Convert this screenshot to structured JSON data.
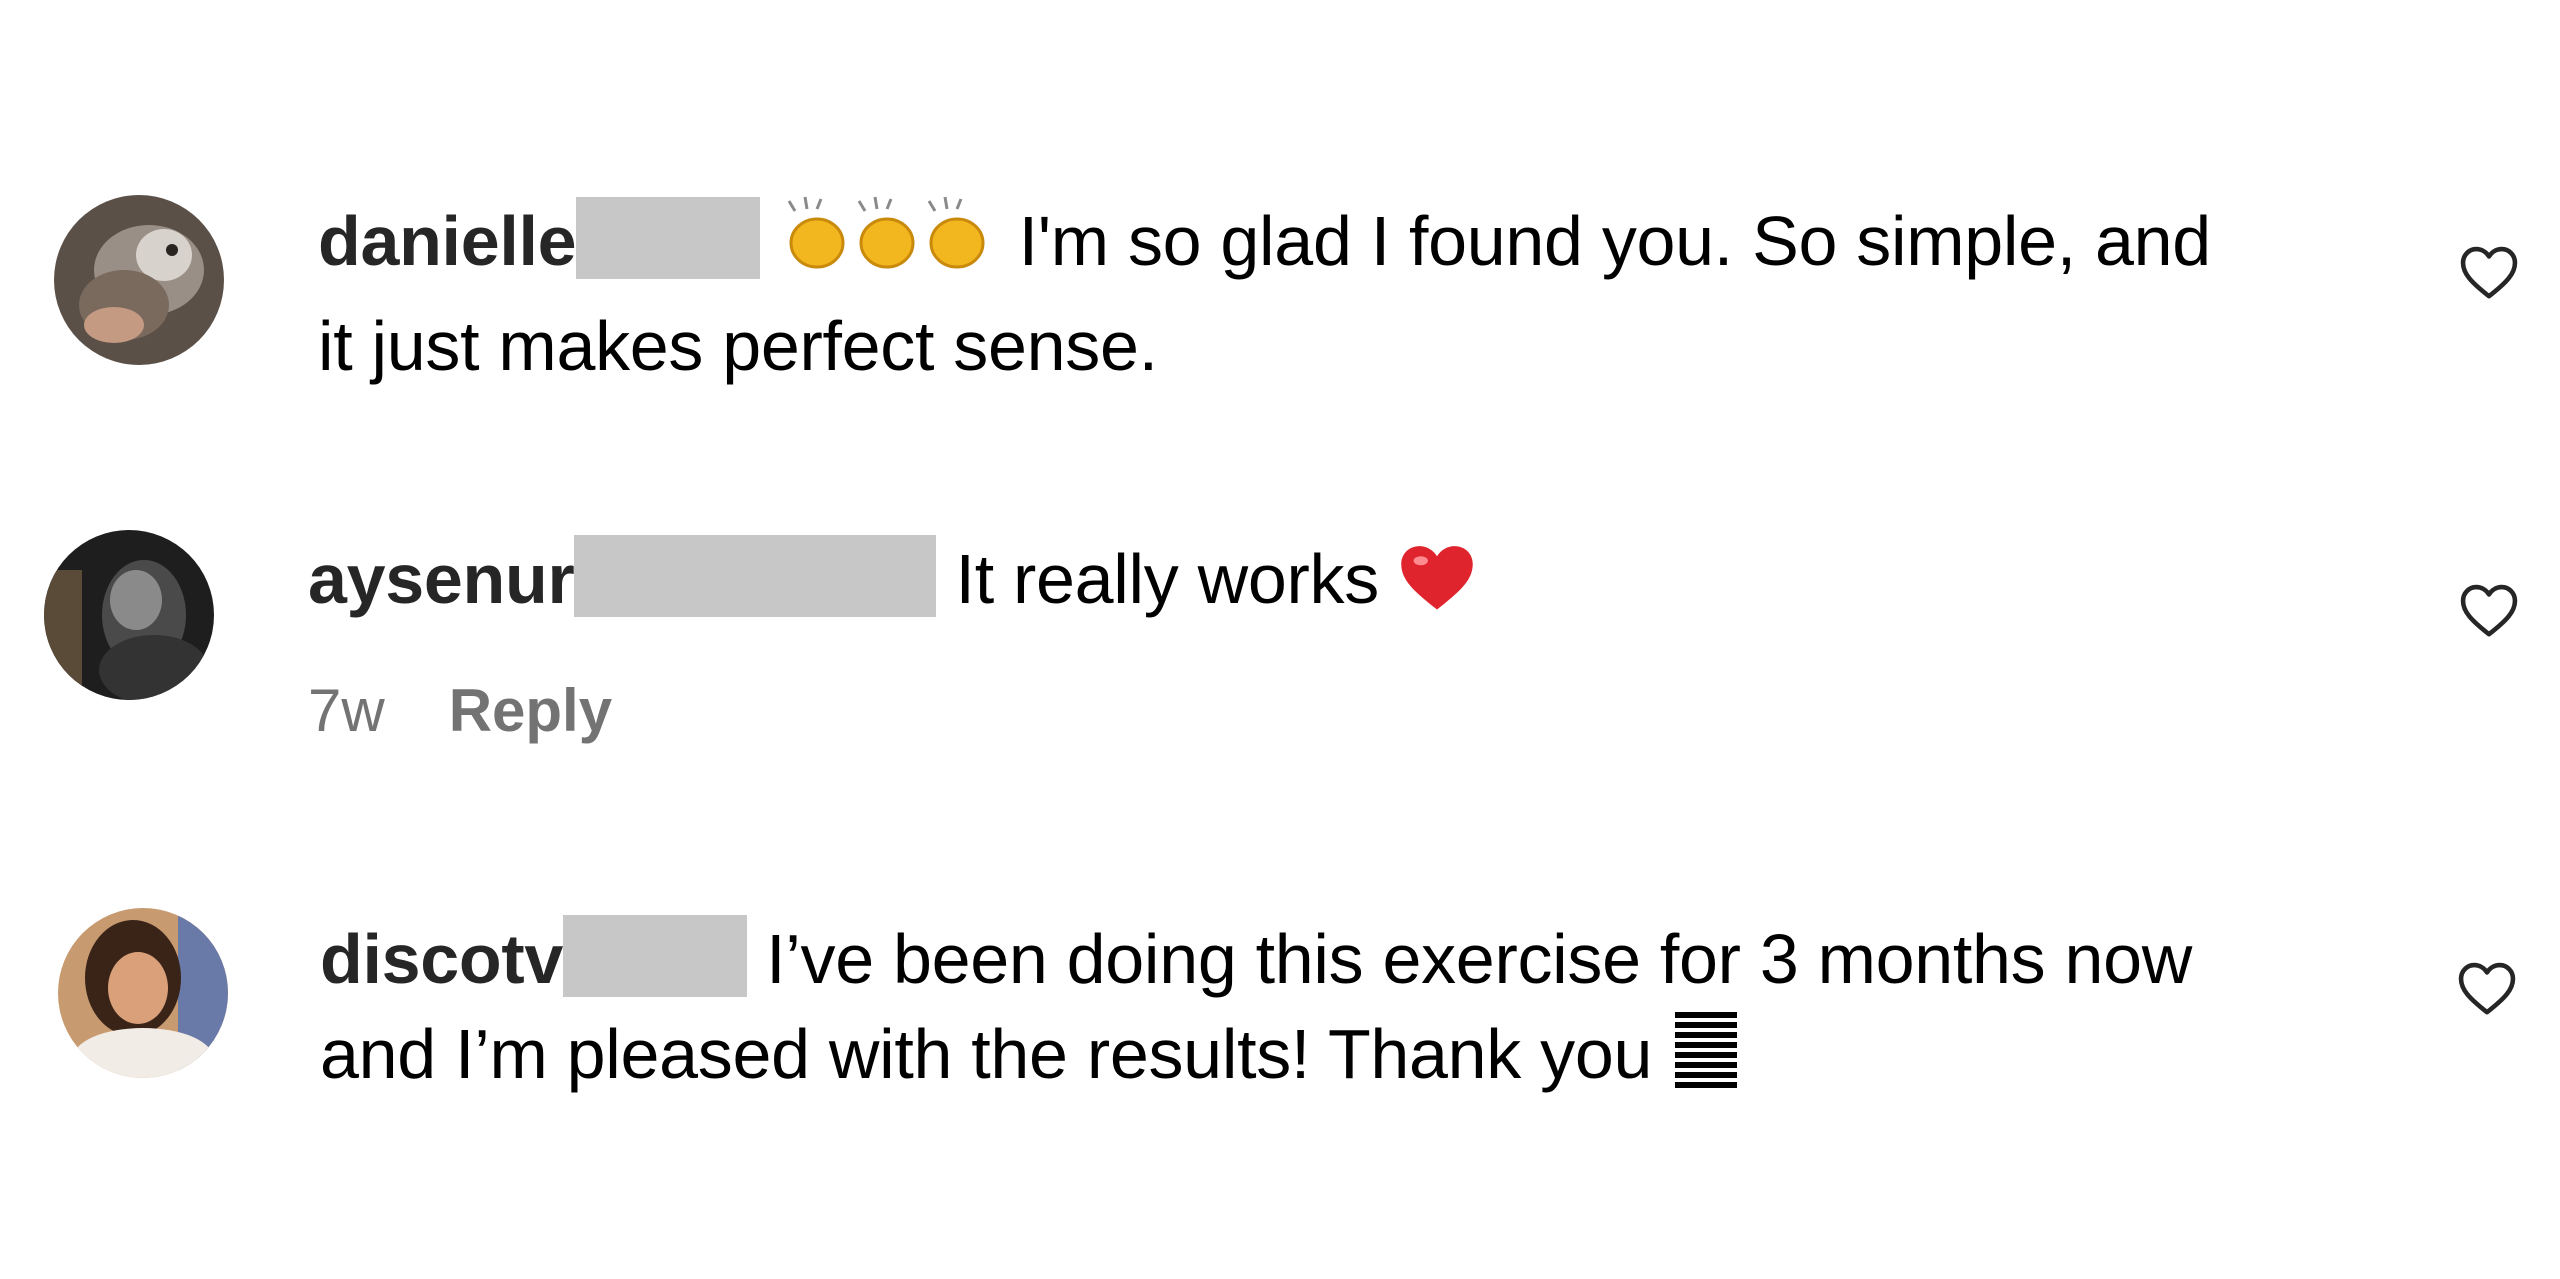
{
  "comments": [
    {
      "username": "danielle",
      "body_line1": "I'm so glad I found you. So simple, and",
      "body_line2": "it just makes perfect sense.",
      "emoji": "clapping-hands-x3"
    },
    {
      "username": "aysenur",
      "body_line1": "It really works",
      "emoji": "red-heart",
      "time": "7w",
      "reply_label": "Reply"
    },
    {
      "username": "discotv",
      "body_line1": "I’ve been doing this exercise for 3 months now",
      "body_line2": "and I’m pleased with the results! Thank you",
      "emoji": "unrendered-glyph"
    }
  ],
  "icons": {
    "like": "heart-outline-icon"
  },
  "colors": {
    "username": "#262626",
    "meta": "#737373",
    "redaction": "#c7c7c7"
  }
}
